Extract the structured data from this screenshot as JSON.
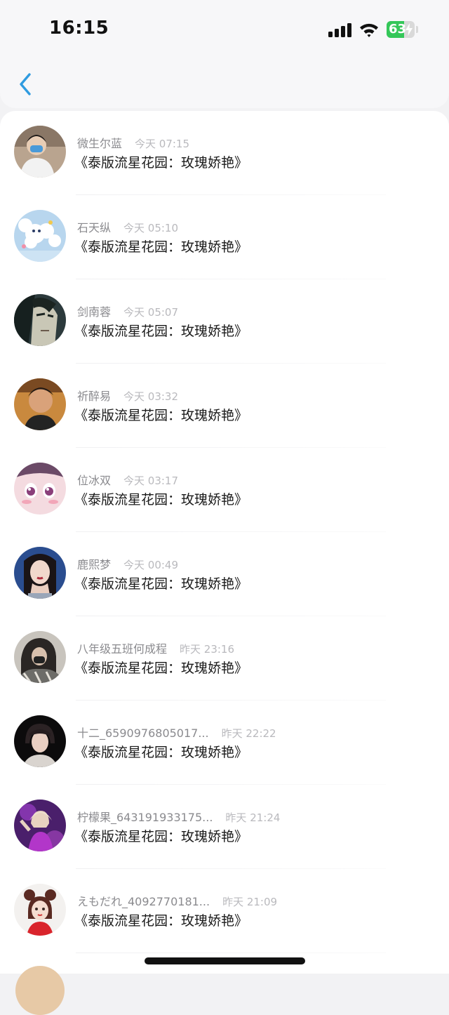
{
  "status_bar": {
    "time": "16:15",
    "battery": "63",
    "battery_level": 0.63,
    "colors": {
      "battery": "#34c759"
    }
  },
  "nav": {
    "back_icon": "chevron-left-icon",
    "accent": "#2f9be0"
  },
  "list": {
    "items": [
      {
        "user": "微生尔蓝",
        "time": "今天 07:15",
        "title": "《泰版流星花园：玫瑰娇艳》"
      },
      {
        "user": "石天纵",
        "time": "今天 05:10",
        "title": "《泰版流星花园：玫瑰娇艳》"
      },
      {
        "user": "剑南蓉",
        "time": "今天 05:07",
        "title": "《泰版流星花园：玫瑰娇艳》"
      },
      {
        "user": "祈醉易",
        "time": "今天 03:32",
        "title": "《泰版流星花园：玫瑰娇艳》"
      },
      {
        "user": "位冰双",
        "time": "今天 03:17",
        "title": "《泰版流星花园：玫瑰娇艳》"
      },
      {
        "user": "鹿熙梦",
        "time": "今天 00:49",
        "title": "《泰版流星花园：玫瑰娇艳》"
      },
      {
        "user": "八年级五班何成程",
        "time": "昨天 23:16",
        "title": "《泰版流星花园：玫瑰娇艳》"
      },
      {
        "user": "十二_6590976805017...",
        "time": "昨天 22:22",
        "title": "《泰版流星花园：玫瑰娇艳》"
      },
      {
        "user": "柠檬果_643191933175...",
        "time": "昨天 21:24",
        "title": "《泰版流星花园：玫瑰娇艳》"
      },
      {
        "user": "えもだれ_4092770181...",
        "time": "昨天 21:09",
        "title": "《泰版流星花园：玫瑰娇艳》"
      }
    ]
  }
}
